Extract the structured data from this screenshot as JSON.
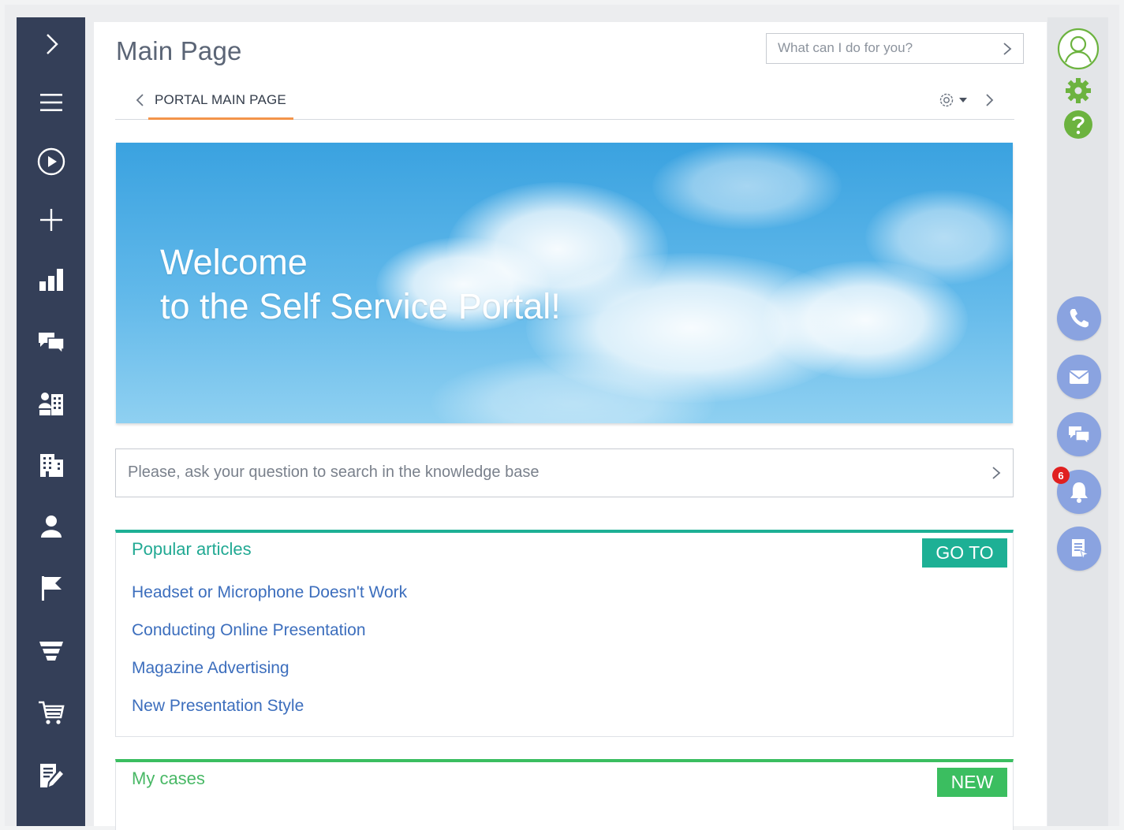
{
  "page": {
    "title": "Main Page"
  },
  "command": {
    "placeholder": "What can I do for you?"
  },
  "tabs": {
    "active_label": "PORTAL MAIN PAGE"
  },
  "banner": {
    "line1": "Welcome",
    "line2": "to the Self Service Portal!"
  },
  "kb_search": {
    "placeholder": "Please, ask your question to search in the knowledge base"
  },
  "popular_articles": {
    "title": "Popular articles",
    "button": "GO TO",
    "items": [
      "Headset or Microphone Doesn't Work",
      "Conducting Online Presentation",
      "Magazine Advertising",
      "New Presentation Style"
    ]
  },
  "my_cases": {
    "title": "My cases",
    "button": "NEW"
  },
  "notifications": {
    "count": "6"
  },
  "colors": {
    "sidebar": "#343f58",
    "tab_accent": "#f3944a",
    "articles_accent": "#1db095",
    "cases_accent": "#3bbe60",
    "link": "#3c6ebd",
    "comm_button": "#8aa3e0",
    "green_icon": "#6cb33f"
  },
  "sidebar_icons": [
    "expand-icon",
    "menu-icon",
    "play-icon",
    "plus-icon",
    "chart-icon",
    "chat-icon",
    "accounts-icon",
    "building-icon",
    "contact-icon",
    "flag-icon",
    "funnel-icon",
    "cart-icon",
    "edit-document-icon"
  ],
  "right_icons": [
    "profile-icon",
    "settings-icon",
    "help-icon",
    "phone-icon",
    "email-icon",
    "chat-icon",
    "bell-icon",
    "feed-icon"
  ]
}
